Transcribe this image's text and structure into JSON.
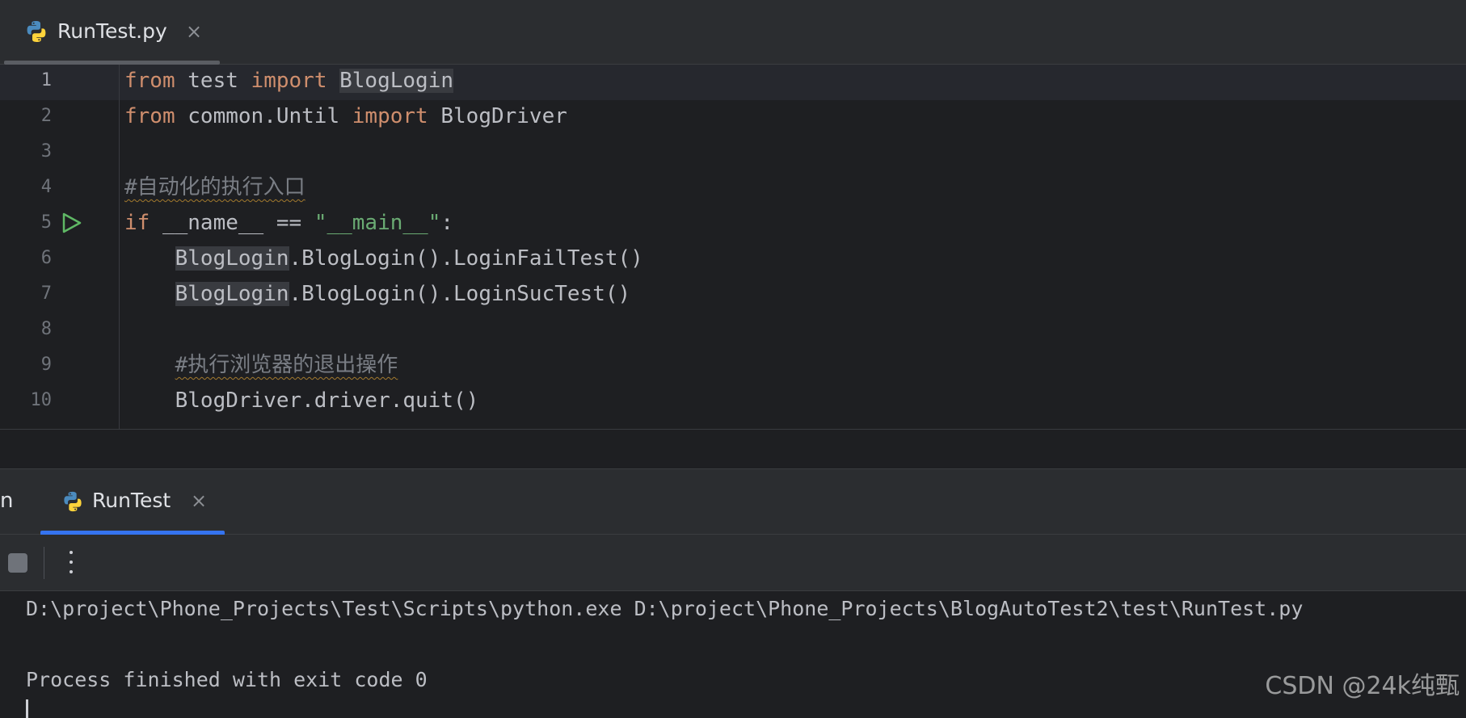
{
  "editor_tab": {
    "filename": "RunTest.py",
    "close_glyph": "×",
    "icon": "python-icon"
  },
  "editor": {
    "line_numbers": [
      "1",
      "2",
      "3",
      "4",
      "5",
      "6",
      "7",
      "8",
      "9",
      "10"
    ],
    "current_line": 1,
    "run_gutter_line": 5,
    "lines": [
      {
        "segments": [
          {
            "t": "from",
            "c": "kw"
          },
          {
            "t": " test ",
            "c": ""
          },
          {
            "t": "import",
            "c": "kw"
          },
          {
            "t": " ",
            "c": ""
          },
          {
            "t": "BlogLogin",
            "c": "hl"
          }
        ]
      },
      {
        "segments": [
          {
            "t": "from",
            "c": "kw"
          },
          {
            "t": " common.Until ",
            "c": ""
          },
          {
            "t": "import",
            "c": "kw"
          },
          {
            "t": " BlogDriver",
            "c": ""
          }
        ]
      },
      {
        "segments": []
      },
      {
        "segments": [
          {
            "t": "#自动化的执行入口",
            "c": "cmt"
          }
        ]
      },
      {
        "segments": [
          {
            "t": "if",
            "c": "kw"
          },
          {
            "t": " __name__ == ",
            "c": ""
          },
          {
            "t": "\"__main__\"",
            "c": "str"
          },
          {
            "t": ":",
            "c": ""
          }
        ]
      },
      {
        "segments": [
          {
            "t": "    ",
            "c": ""
          },
          {
            "t": "BlogLogin",
            "c": "hl"
          },
          {
            "t": ".BlogLogin().LoginFailTest()",
            "c": ""
          }
        ]
      },
      {
        "segments": [
          {
            "t": "    ",
            "c": ""
          },
          {
            "t": "BlogLogin",
            "c": "hl"
          },
          {
            "t": ".BlogLogin().LoginSucTest()",
            "c": ""
          }
        ]
      },
      {
        "segments": []
      },
      {
        "segments": [
          {
            "t": "    ",
            "c": ""
          },
          {
            "t": "#执行浏览器的退出操作",
            "c": "cmt"
          }
        ]
      },
      {
        "segments": [
          {
            "t": "    BlogDriver.driver.quit()",
            "c": ""
          }
        ]
      }
    ]
  },
  "run_panel": {
    "cut_label": "n",
    "tab_label": "RunTest",
    "close_glyph": "×",
    "accent_color": "#3574f0"
  },
  "toolbar": {
    "stop": "stop-icon",
    "more": "more-vertical-icon"
  },
  "console": {
    "command": "D:\\project\\Phone_Projects\\Test\\Scripts\\python.exe D:\\project\\Phone_Projects\\BlogAutoTest2\\test\\RunTest.py",
    "exit_message": "Process finished with exit code 0"
  },
  "watermark": "CSDN @24k纯甄"
}
